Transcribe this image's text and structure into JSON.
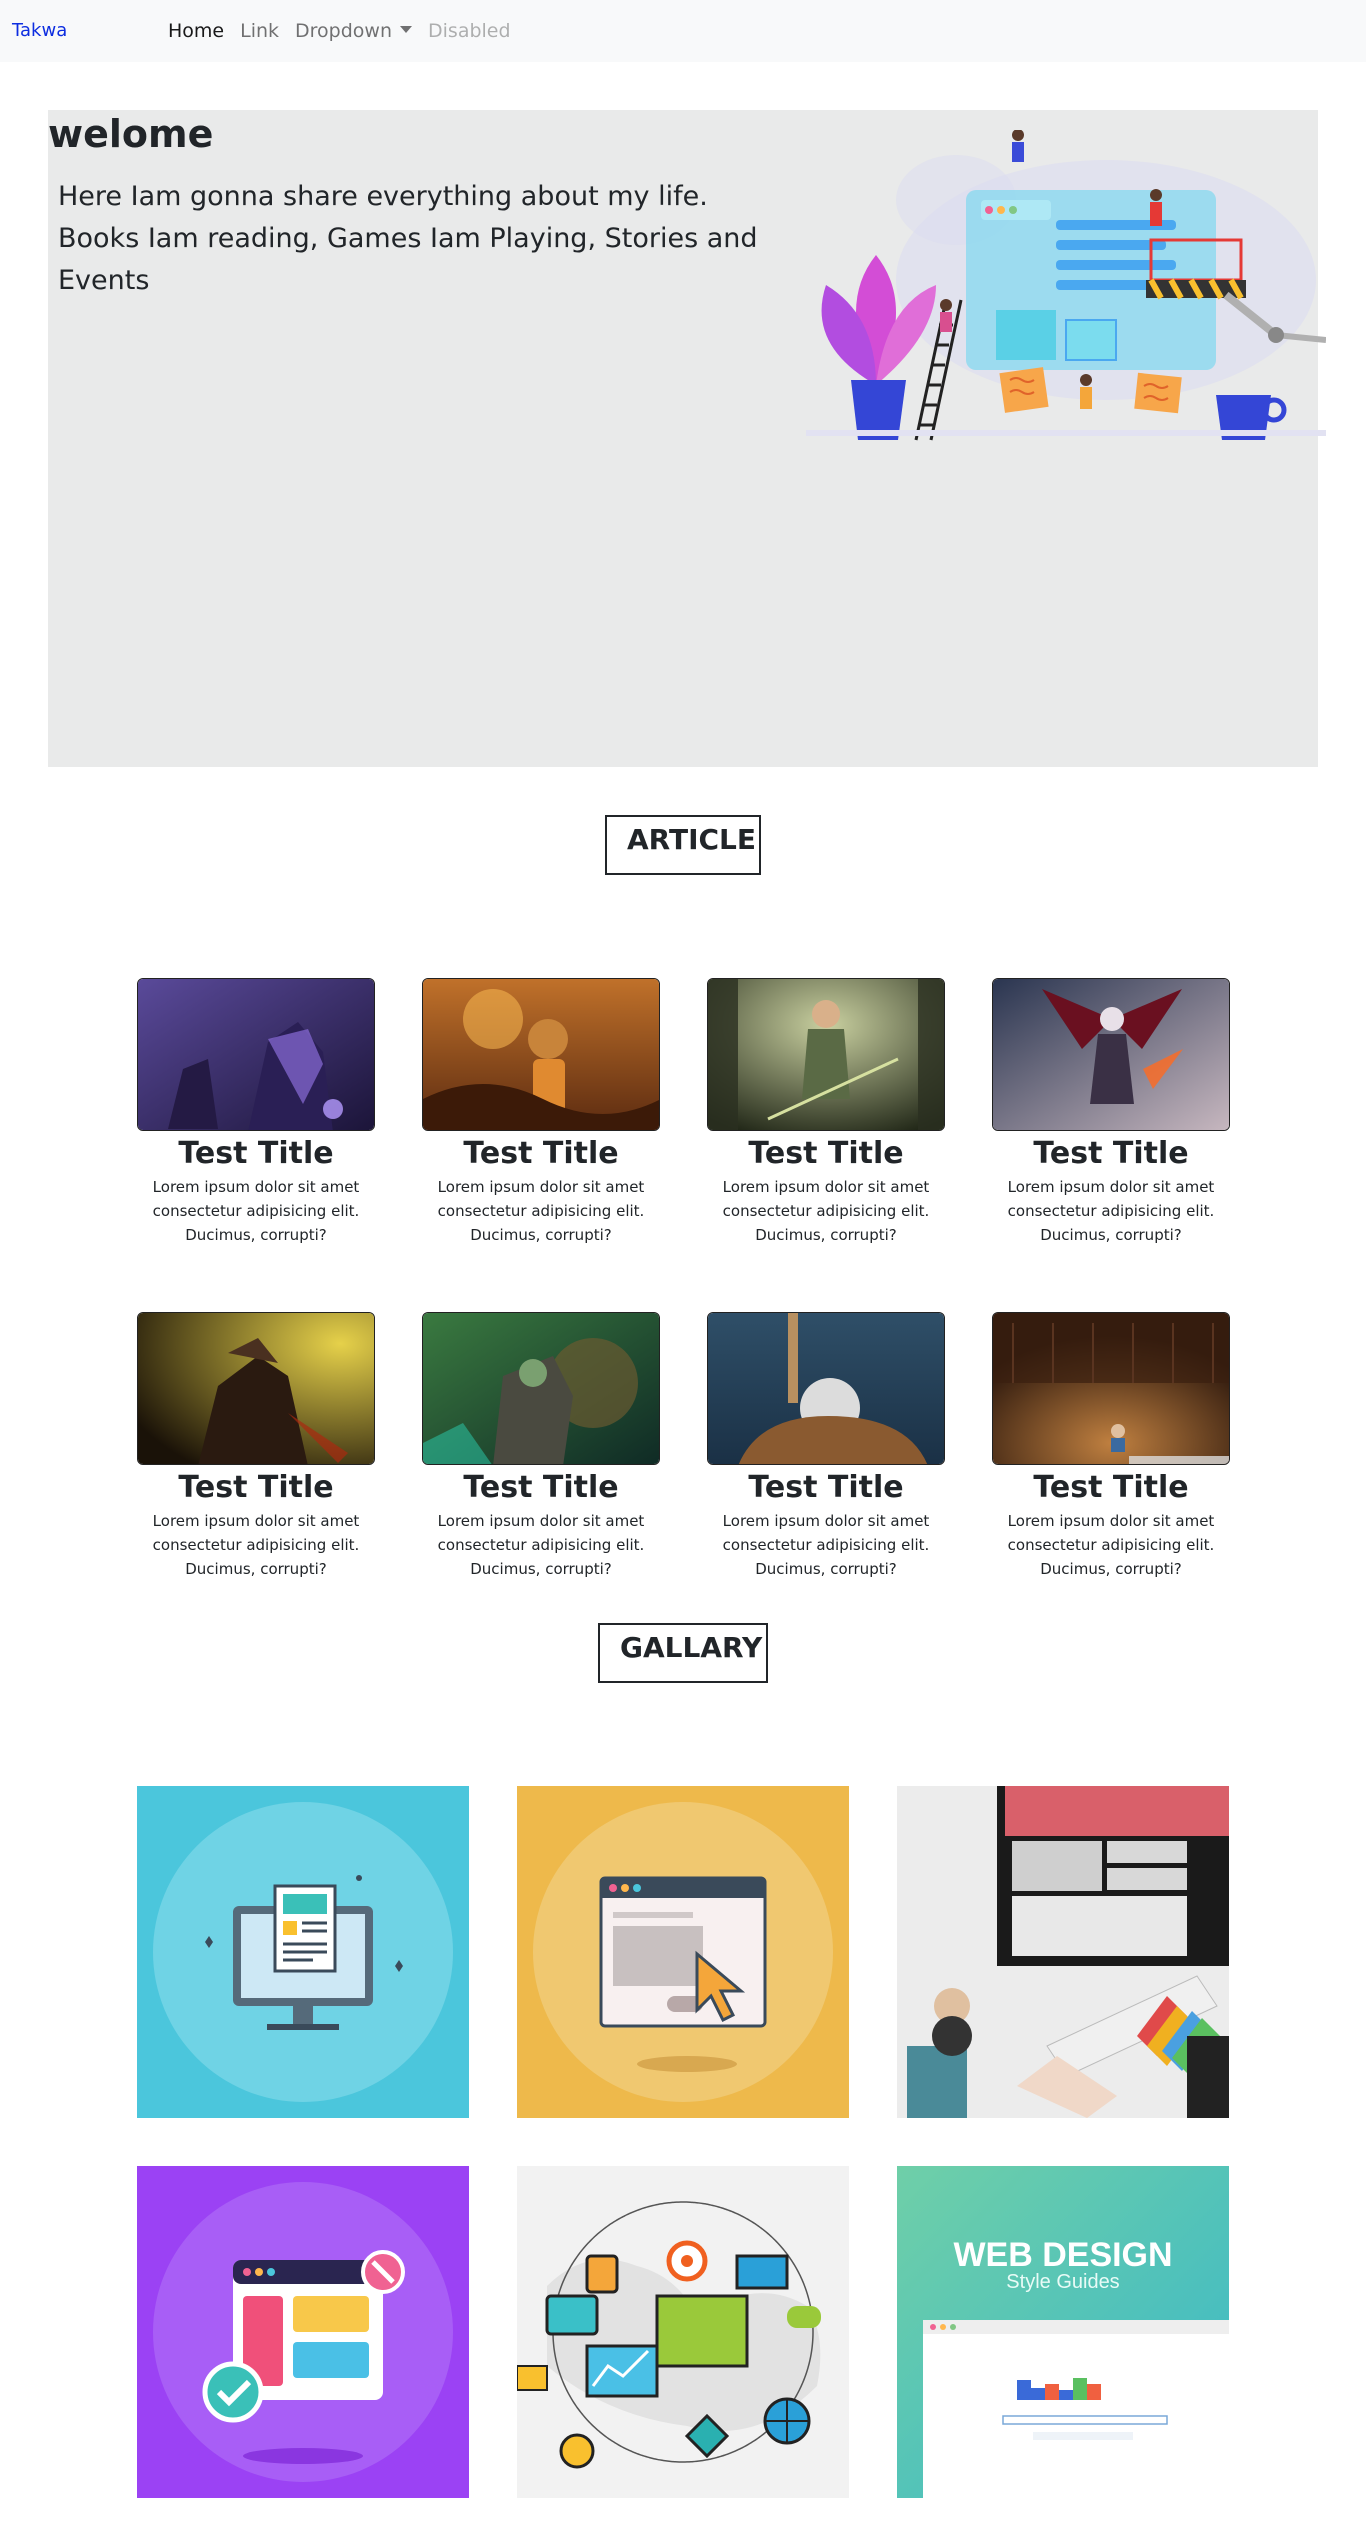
{
  "navbar": {
    "brand": "Takwa",
    "links": [
      {
        "label": "Home"
      },
      {
        "label": "Link"
      },
      {
        "label": "Dropdown"
      },
      {
        "label": "Disabled"
      }
    ]
  },
  "hero": {
    "title": "welome",
    "text": "Here Iam gonna share everything about my life. Books Iam reading, Games Iam Playing, Stories and Events"
  },
  "article": {
    "heading": "ARTICLE",
    "cards": [
      {
        "title": "Test Title",
        "text": "Lorem ipsum dolor sit amet consectetur adipisicing elit. Ducimus, corrupti?"
      },
      {
        "title": "Test Title",
        "text": "Lorem ipsum dolor sit amet consectetur adipisicing elit. Ducimus, corrupti?"
      },
      {
        "title": "Test Title",
        "text": "Lorem ipsum dolor sit amet consectetur adipisicing elit. Ducimus, corrupti?"
      },
      {
        "title": "Test Title",
        "text": "Lorem ipsum dolor sit amet consectetur adipisicing elit. Ducimus, corrupti?"
      },
      {
        "title": "Test Title",
        "text": "Lorem ipsum dolor sit amet consectetur adipisicing elit. Ducimus, corrupti?"
      },
      {
        "title": "Test Title",
        "text": "Lorem ipsum dolor sit amet consectetur adipisicing elit. Ducimus, corrupti?"
      },
      {
        "title": "Test Title",
        "text": "Lorem ipsum dolor sit amet consectetur adipisicing elit. Ducimus, corrupti?"
      },
      {
        "title": "Test Title",
        "text": "Lorem ipsum dolor sit amet consectetur adipisicing elit. Ducimus, corrupti?"
      }
    ]
  },
  "gallery": {
    "heading": "GALLARY",
    "tile6_title": "WEB DESIGN",
    "tile6_subtitle": "Style Guides"
  },
  "colors": {
    "brand": "#0d2de0",
    "hero_bg": "#e9eaea",
    "navbar_bg": "#f8f9fa",
    "tile_cyan": "#4bc6dc",
    "tile_yellow": "#eeb94b",
    "tile_purple": "#9b42f4",
    "tile_teal": "#5fc9b0"
  }
}
